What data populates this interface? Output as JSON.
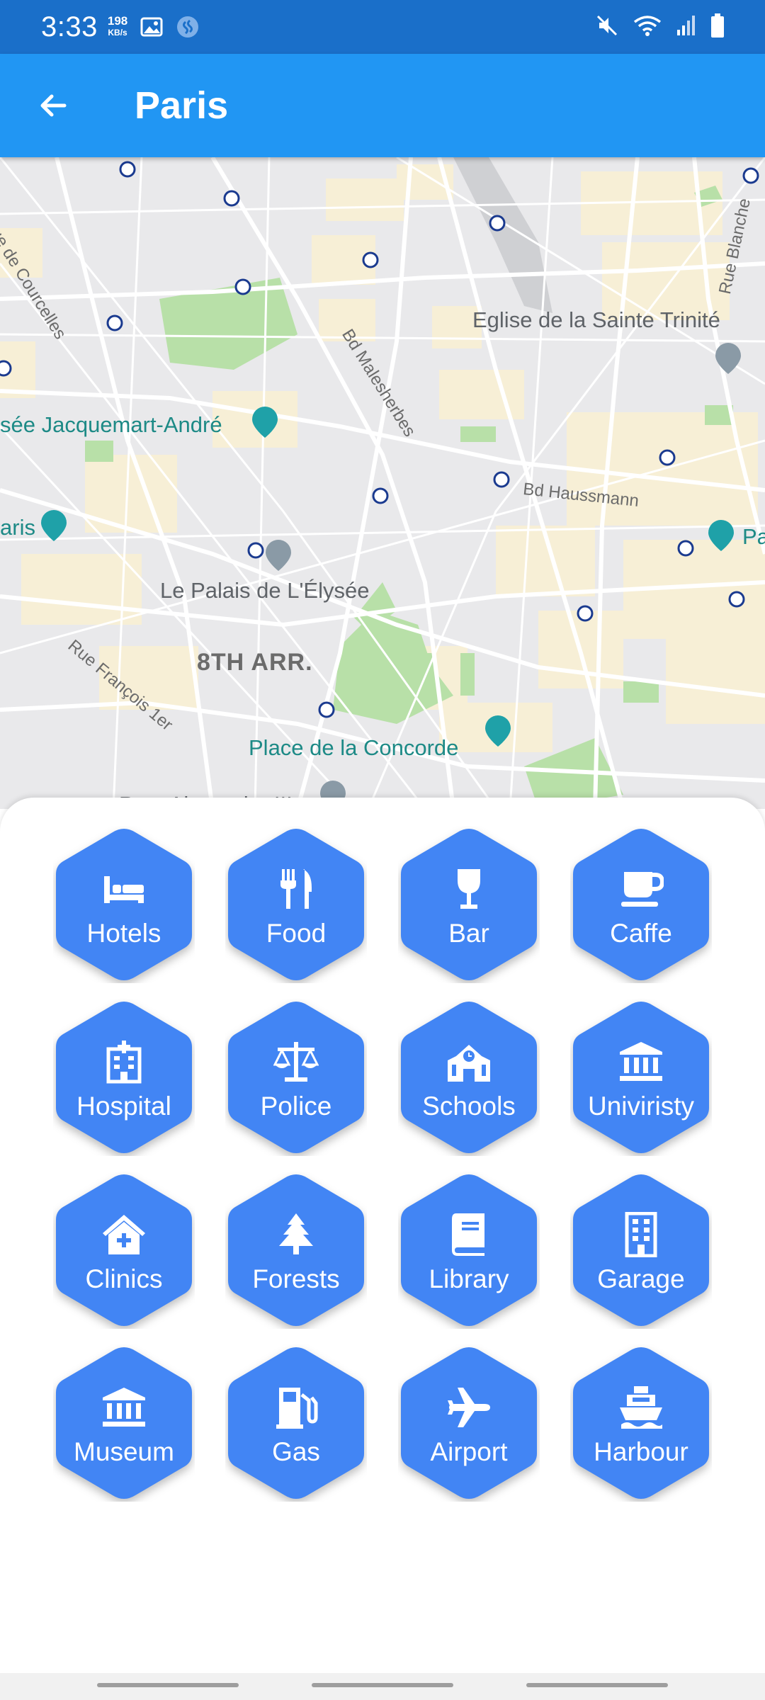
{
  "status_bar": {
    "time": "3:33",
    "speed_value": "198",
    "speed_unit": "KB/s",
    "icons": [
      "image-icon",
      "shazam-icon",
      "mute-icon",
      "wifi-icon",
      "signal-icon",
      "battery-icon"
    ]
  },
  "app_bar": {
    "title": "Paris",
    "back_icon": "arrow-left-icon"
  },
  "map": {
    "labels": {
      "rue_courcelles": "Rue de Courcelles",
      "bd_malesherbes": "Bd Malesherbes",
      "rue_blanche": "Rue Blanche",
      "eglise": "Eglise de la Sainte Trinité",
      "jacquemart": "sée Jacquemart-André",
      "bd_haussmann": "Bd Haussmann",
      "aris": "aris",
      "pa": "Pa",
      "palais": "Le Palais de L'Élysée",
      "rue_francois": "Rue François 1er",
      "arr": "8TH ARR.",
      "concorde": "Place de la Concorde",
      "pont": "Pont Alexandre III"
    }
  },
  "categories": [
    {
      "label": "Hotels",
      "icon": "bed-icon"
    },
    {
      "label": "Food",
      "icon": "fork-knife-icon"
    },
    {
      "label": "Bar",
      "icon": "wine-glass-icon"
    },
    {
      "label": "Caffe",
      "icon": "coffee-cup-icon"
    },
    {
      "label": "Hospital",
      "icon": "hospital-icon"
    },
    {
      "label": "Police",
      "icon": "scales-icon"
    },
    {
      "label": "Schools",
      "icon": "school-icon"
    },
    {
      "label": "Univiristy",
      "icon": "university-icon"
    },
    {
      "label": "Clinics",
      "icon": "clinic-house-icon"
    },
    {
      "label": "Forests",
      "icon": "tree-icon"
    },
    {
      "label": "Library",
      "icon": "book-icon"
    },
    {
      "label": "Garage",
      "icon": "building-icon"
    },
    {
      "label": "Museum",
      "icon": "museum-icon"
    },
    {
      "label": "Gas",
      "icon": "gas-pump-icon"
    },
    {
      "label": "Airport",
      "icon": "plane-icon"
    },
    {
      "label": "Harbour",
      "icon": "ship-icon"
    }
  ],
  "colors": {
    "status_bar": "#1a6fc9",
    "app_bar": "#2196f3",
    "hex_fill": "#4285f4",
    "map_bg": "#e9e9eb"
  }
}
